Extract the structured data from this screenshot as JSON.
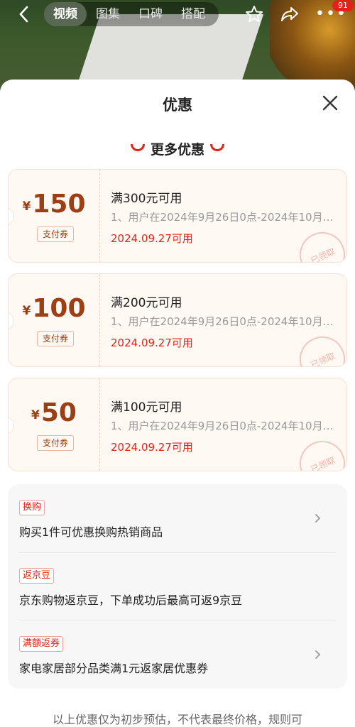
{
  "top_bar": {
    "tabs": [
      {
        "label": "视频",
        "active": true
      },
      {
        "label": "图集",
        "active": false
      },
      {
        "label": "口碑",
        "active": false
      },
      {
        "label": "搭配",
        "active": false
      }
    ],
    "badge_count": "91",
    "icons": {
      "back": "back-arrow-icon",
      "star": "star-icon",
      "share": "share-icon",
      "more": "more-icon"
    }
  },
  "sheet": {
    "title": "优惠",
    "subtitle": "更多优惠",
    "coupons": [
      {
        "currency": "¥",
        "amount": "150",
        "tag": "支付券",
        "condition": "满300元可用",
        "desc": "1、用户在2024年9月26日0点-2024年10月…",
        "date": "2024.09.27可用",
        "stamp": "已领取"
      },
      {
        "currency": "¥",
        "amount": "100",
        "tag": "支付券",
        "condition": "满200元可用",
        "desc": "1、用户在2024年9月26日0点-2024年10月…",
        "date": "2024.09.27可用",
        "stamp": "已领取"
      },
      {
        "currency": "¥",
        "amount": "50",
        "tag": "支付券",
        "condition": "满100元可用",
        "desc": "1、用户在2024年9月26日0点-2024年10月…",
        "date": "2024.09.27可用",
        "stamp": "已领取"
      }
    ],
    "promos": [
      {
        "label": "换购",
        "text": "购买1件可优惠换购热销商品",
        "has_arrow": true
      },
      {
        "label": "返京豆",
        "text": "京东购物返京豆，下单成功后最高可返9京豆",
        "has_arrow": false
      },
      {
        "label": "满额返券",
        "text": "家电家居部分品类满1元返家居优惠券",
        "has_arrow": true
      }
    ],
    "footer": "以上优惠仅为初步预估，不代表最终价格，规则可"
  },
  "colors": {
    "accent": "#e2231a",
    "coupon_text": "#9b3f14",
    "coupon_bg": "#fff8f3"
  }
}
